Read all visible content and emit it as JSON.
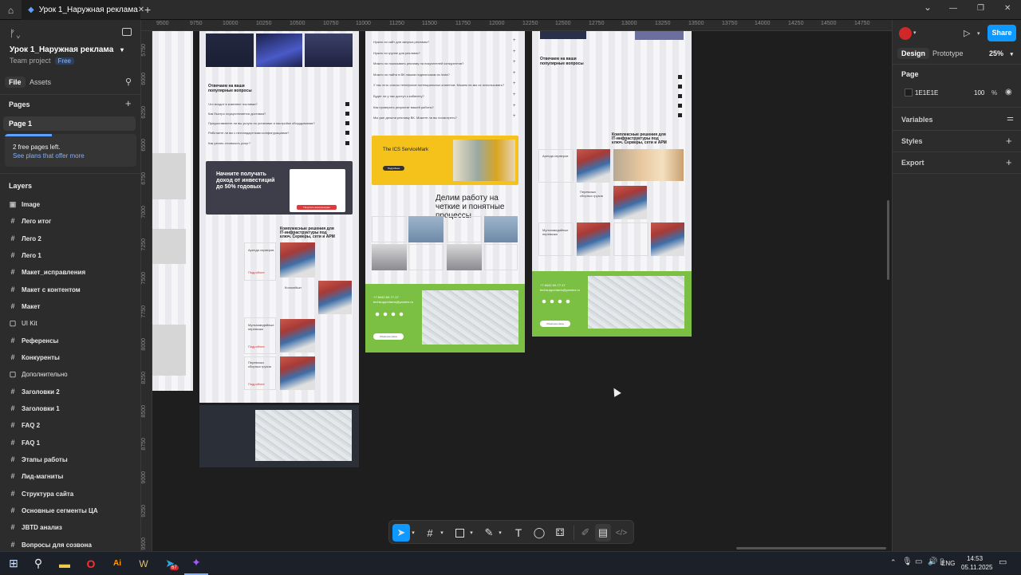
{
  "titlebar": {
    "home_icon": "home-icon",
    "tab_title": "Урок 1_Наружная реклама",
    "new_tab": "+",
    "chevron": "⌄",
    "minimize": "—",
    "maximize": "❐",
    "close": "✕"
  },
  "left_panel": {
    "file_name": "Урок 1_Наружная реклама",
    "team": "Team project",
    "plan_badge": "Free",
    "tabs": [
      "File",
      "Assets"
    ],
    "pages_header": "Pages",
    "pages": [
      "Page 1"
    ],
    "free_pages_text": "2 free pages left.",
    "free_pages_link": "See plans that offer more",
    "layers_header": "Layers",
    "layers": [
      {
        "name": "Image",
        "icon": "image-icon"
      },
      {
        "name": "Лего итог",
        "icon": "frame-icon"
      },
      {
        "name": "Лего 2",
        "icon": "frame-icon"
      },
      {
        "name": "Лего 1",
        "icon": "frame-icon"
      },
      {
        "name": "Макет_исправления",
        "icon": "frame-icon"
      },
      {
        "name": "Макет с контентом",
        "icon": "frame-icon"
      },
      {
        "name": "Макет",
        "icon": "frame-icon"
      },
      {
        "name": "UI Kit",
        "icon": "section-icon"
      },
      {
        "name": "Референсы",
        "icon": "frame-icon"
      },
      {
        "name": "Конкуренты",
        "icon": "frame-icon"
      },
      {
        "name": "Дополнительно",
        "icon": "section-icon"
      },
      {
        "name": "Заголовки 2",
        "icon": "frame-icon"
      },
      {
        "name": "Заголовки 1",
        "icon": "frame-icon"
      },
      {
        "name": "FAQ 2",
        "icon": "frame-icon"
      },
      {
        "name": "FAQ 1",
        "icon": "frame-icon"
      },
      {
        "name": "Этапы работы",
        "icon": "frame-icon"
      },
      {
        "name": "Лид-магниты",
        "icon": "frame-icon"
      },
      {
        "name": "Структура сайта",
        "icon": "frame-icon"
      },
      {
        "name": "Основные сегменты ЦА",
        "icon": "frame-icon"
      },
      {
        "name": "JBTD анализ",
        "icon": "frame-icon"
      },
      {
        "name": "Вопросы для созвона",
        "icon": "frame-icon"
      }
    ]
  },
  "ruler": {
    "top": [
      "9500",
      "9750",
      "10000",
      "10250",
      "10500",
      "10750",
      "11000",
      "11250",
      "11500",
      "11750",
      "12000",
      "12250",
      "12500",
      "12750",
      "13000",
      "13250",
      "13500",
      "13750",
      "14000",
      "14250",
      "14500",
      "14750"
    ],
    "left": [
      "5750",
      "6000",
      "6250",
      "6500",
      "6750",
      "7000",
      "7250",
      "7500",
      "7750",
      "8000",
      "8250",
      "8500",
      "8750",
      "9000",
      "9250",
      "9500"
    ]
  },
  "right_panel": {
    "tabs": [
      "Design",
      "Prototype"
    ],
    "zoom": "25%",
    "share": "Share",
    "page_section": "Page",
    "bg_color_hex": "1E1E1E",
    "bg_opacity": "100",
    "percent": "%",
    "variables": "Variables",
    "styles": "Styles",
    "export": "Export"
  },
  "canvas": {
    "frame1": {
      "faq_title": "Отвечаем на ваши популярные вопросы",
      "faq_items": [
        "Что входит в комплект поставки?",
        "Как быстро осуществляется доставка?",
        "Предоставляете ли вы услуги по установке и настройке оборудования?",
        "Работаете ли вы с нестандартными конфигурациями?",
        "Как узнать стоимость услуг?"
      ],
      "promo_title": "Начните получать доход от инвестиций до 50% годовых",
      "promo_button": "Получить консультацию",
      "solutions_title": "Комплексные решения для IT-инфраструктуры под ключ. Серверы, сети и АРМ",
      "solutions_items": [
        "Аренда серверов",
        "Колокейшн",
        "Мультимедийные перевозки",
        "Перевозка сборных грузов"
      ],
      "detail_link": "Подробнее"
    },
    "frame2": {
      "faq_items": [
        "Нужно ли сайт для запуска рекламы?",
        "Нужно ли группе для рекламы?",
        "Можно ли показывать рекламу на покупателей конкурентов?",
        "Можно ли найти в ВК нашим подписчикам из Insta?",
        "У нас есть список телефонов потенциальных клиентов. Можем ли мы их использовать?",
        "Будет ли у нас доступ к кабинету?",
        "Как проверить результат вашей работы?",
        "Мы уже делали рекламу ВК. Можете ли вы посмотреть?"
      ],
      "banner_title": "The ICS ServiceMark",
      "banner_button": "Подробнее",
      "process_title": "Делим работу на четкие и понятные процессы",
      "phone": "+7 8442 60-77-17",
      "email": "techsupportams@yandex.ru",
      "feedback_button": "Обратная связь"
    },
    "frame3": {
      "faq_title": "Отвечаем на ваши популярные вопросы",
      "solutions_title": "Комплексные решения для IT-инфраструктуры под ключ. Серверы, сети и АРМ",
      "solutions_items": [
        "Аренда серверов",
        "Перевозка сборных грузов",
        "Мультимедийные перевозки"
      ],
      "phone": "+7 8442 60-77-17",
      "email": "techsupportams@yandex.ru",
      "feedback_button": "Обратная связь"
    }
  },
  "toolbar": {
    "tools": [
      "move-tool",
      "frame-tool",
      "shape-tool",
      "pen-tool",
      "text-tool",
      "comment-tool",
      "actions-tool",
      "draw-mode",
      "design-mode",
      "dev-mode"
    ]
  },
  "help_button": "?",
  "taskbar": {
    "language": "ENG",
    "time": "14:53",
    "date": "05.11.2025",
    "telegram_badge": "67"
  }
}
